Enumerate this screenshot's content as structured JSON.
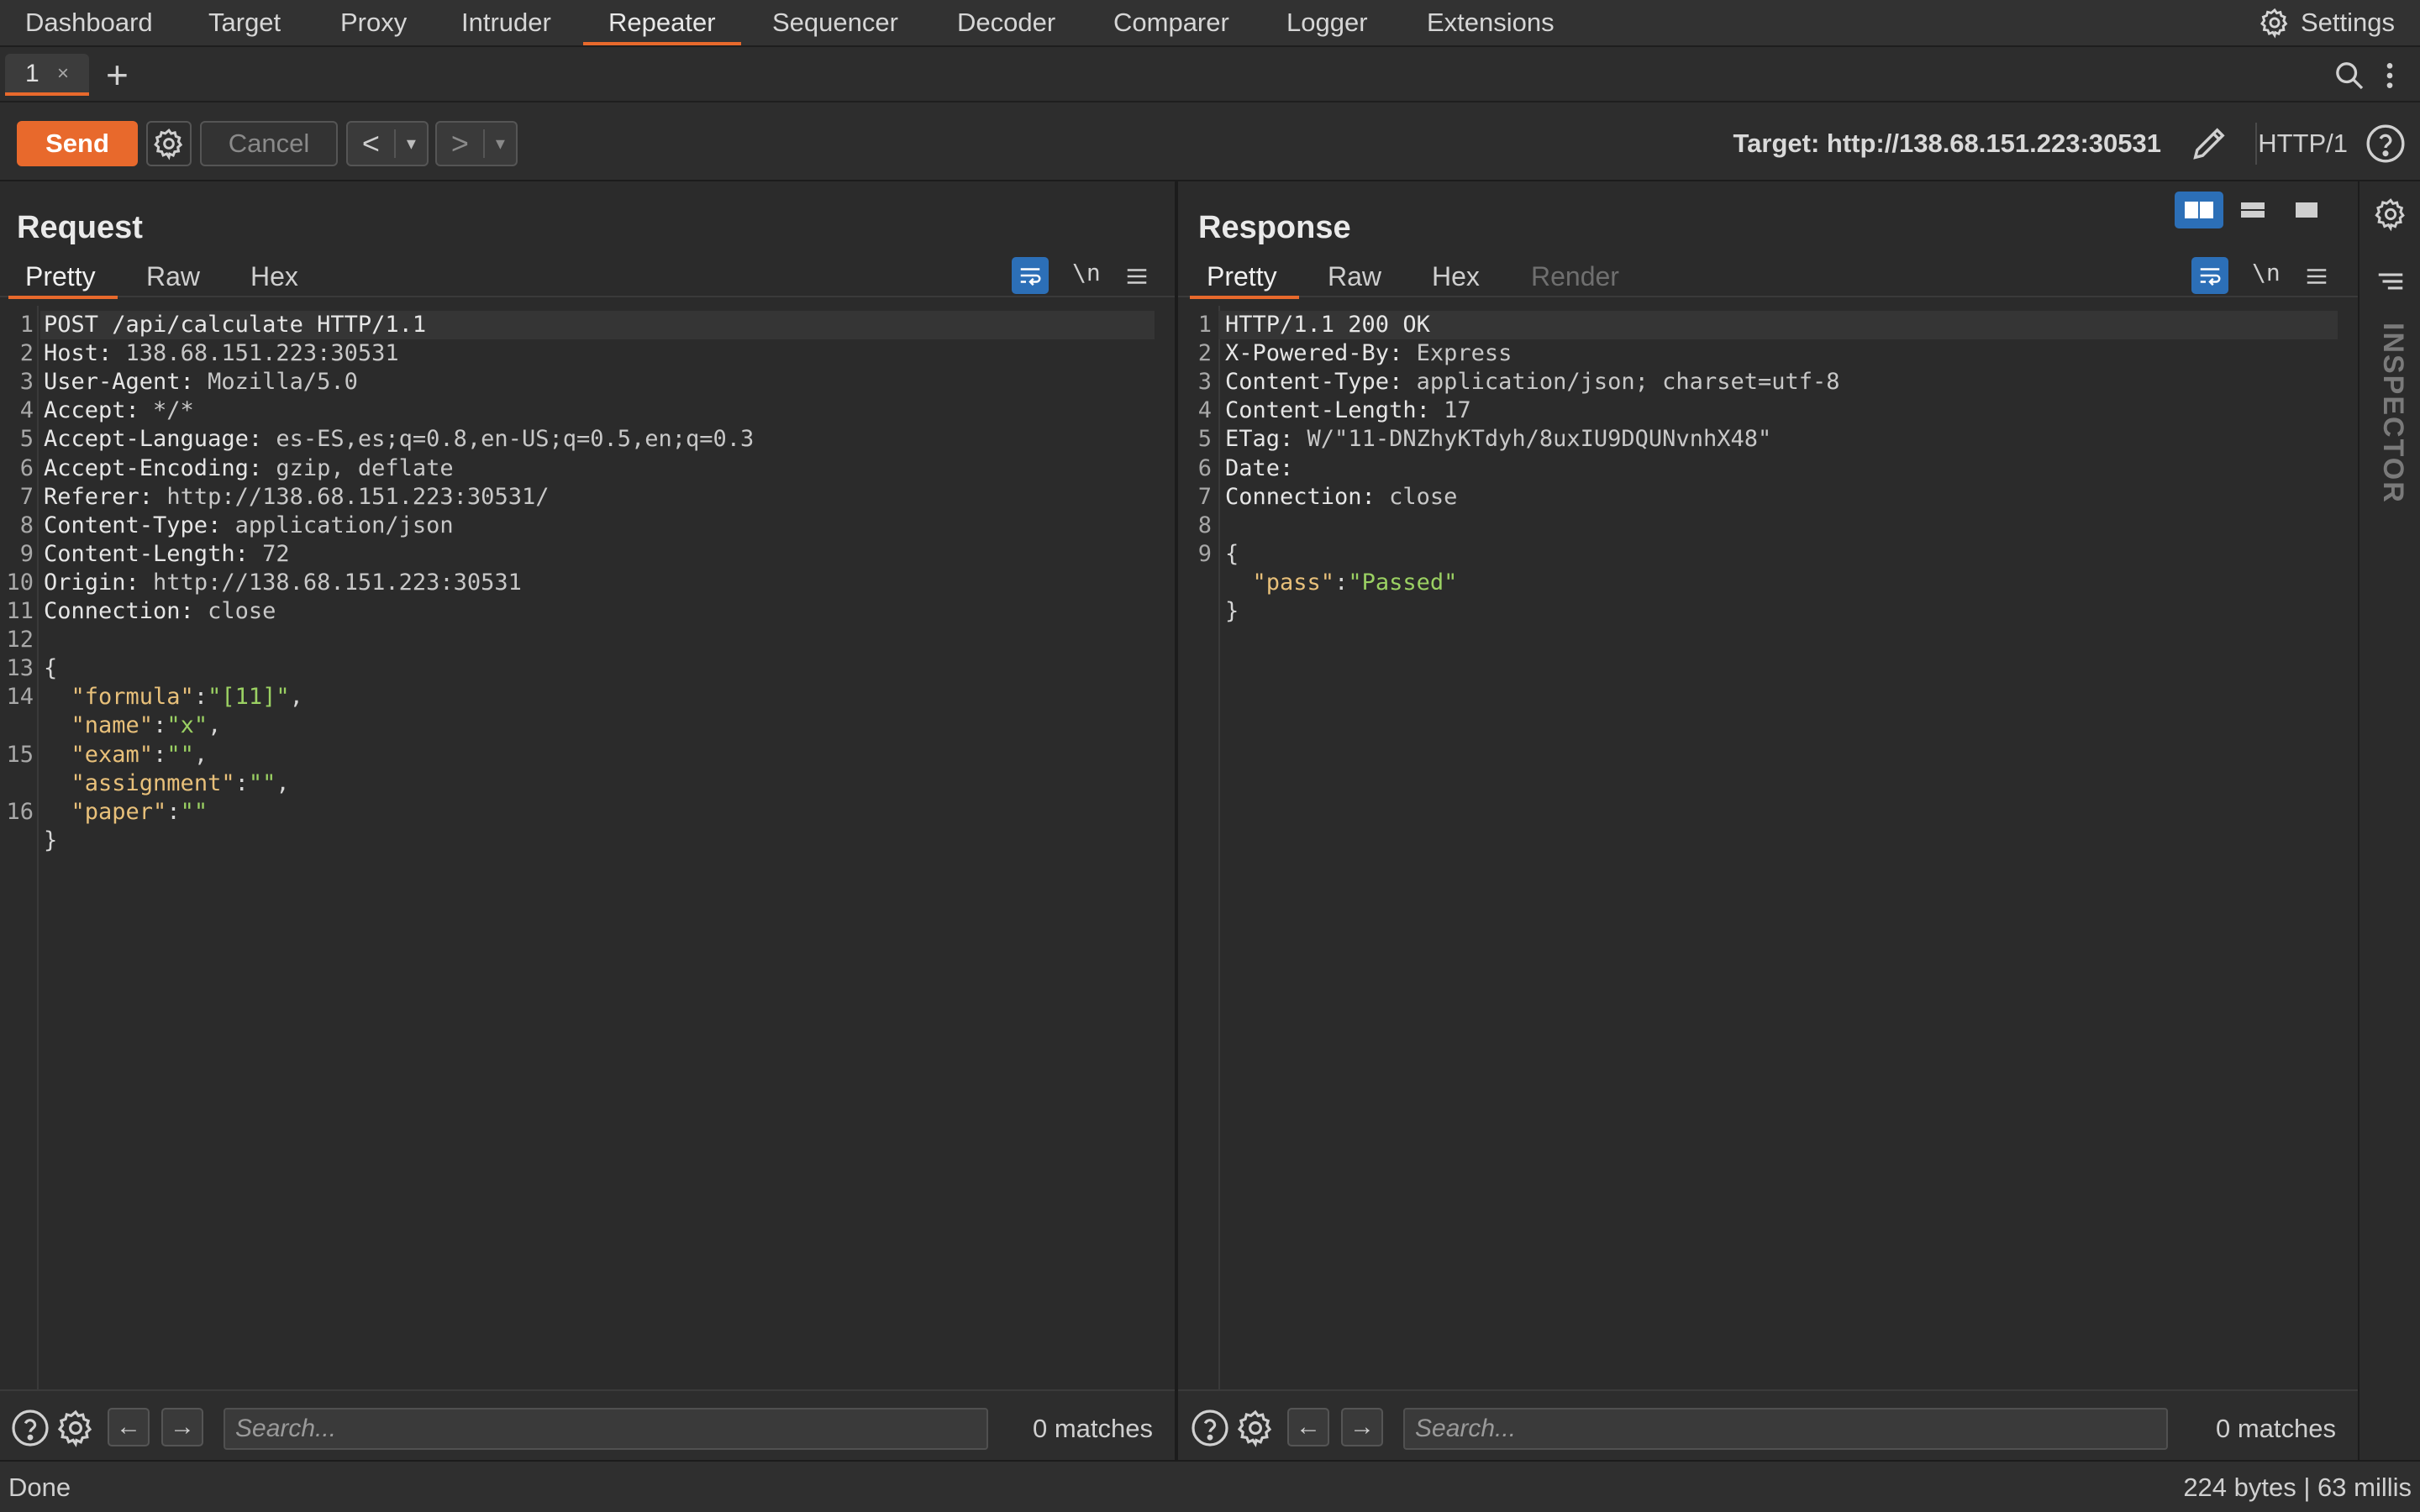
{
  "nav": {
    "items": [
      "Dashboard",
      "Target",
      "Proxy",
      "Intruder",
      "Repeater",
      "Sequencer",
      "Decoder",
      "Comparer",
      "Logger",
      "Extensions"
    ],
    "active": "Repeater",
    "settings_label": "Settings"
  },
  "tabs": {
    "items": [
      {
        "label": "1",
        "close": "×"
      }
    ],
    "add_label": "+"
  },
  "toolbar": {
    "send_label": "Send",
    "cancel_label": "Cancel",
    "back_label": "<",
    "forward_label": ">",
    "dropdown_glyph": "▾",
    "target_label": "Target: http://138.68.151.223:30531",
    "http_version": "HTTP/1"
  },
  "request": {
    "title": "Request",
    "tabs": [
      "Pretty",
      "Raw",
      "Hex"
    ],
    "active_tab": "Pretty",
    "newline_label": "\\n",
    "lines": [
      {
        "n": "1",
        "parts": [
          [
            "hk",
            "POST /api/calculate HTTP/1.1"
          ]
        ]
      },
      {
        "n": "2",
        "parts": [
          [
            "hk",
            "Host: "
          ],
          [
            "hv",
            "138.68.151.223:30531"
          ]
        ]
      },
      {
        "n": "3",
        "parts": [
          [
            "hk",
            "User-Agent: "
          ],
          [
            "hv",
            "Mozilla/5.0"
          ]
        ]
      },
      {
        "n": "4",
        "parts": [
          [
            "hk",
            "Accept: "
          ],
          [
            "hv",
            "*/*"
          ]
        ]
      },
      {
        "n": "5",
        "parts": [
          [
            "hk",
            "Accept-Language: "
          ],
          [
            "hv",
            "es-ES,es;q=0.8,en-US;q=0.5,en;q=0.3"
          ]
        ]
      },
      {
        "n": "6",
        "parts": [
          [
            "hk",
            "Accept-Encoding: "
          ],
          [
            "hv",
            "gzip, deflate"
          ]
        ]
      },
      {
        "n": "7",
        "parts": [
          [
            "hk",
            "Referer: "
          ],
          [
            "hv",
            "http://138.68.151.223:30531/"
          ]
        ]
      },
      {
        "n": "8",
        "parts": [
          [
            "hk",
            "Content-Type: "
          ],
          [
            "hv",
            "application/json"
          ]
        ]
      },
      {
        "n": "9",
        "parts": [
          [
            "hk",
            "Content-Length: "
          ],
          [
            "hv",
            "72"
          ]
        ]
      },
      {
        "n": "10",
        "parts": [
          [
            "hk",
            "Origin: "
          ],
          [
            "hv",
            "http://138.68.151.223:30531"
          ]
        ]
      },
      {
        "n": "11",
        "parts": [
          [
            "hk",
            "Connection: "
          ],
          [
            "hv",
            "close"
          ]
        ]
      },
      {
        "n": "12",
        "parts": []
      },
      {
        "n": "13",
        "parts": [
          [
            "jp",
            "{"
          ]
        ]
      },
      {
        "n": "14",
        "parts": [
          [
            "jp",
            "  "
          ],
          [
            "jk",
            "\"formula\""
          ],
          [
            "jp",
            ":"
          ],
          [
            "jv",
            "\"[11]\""
          ],
          [
            "jp",
            ","
          ]
        ]
      },
      {
        "n": "",
        "parts": [
          [
            "jp",
            "  "
          ],
          [
            "jk",
            "\"name\""
          ],
          [
            "jp",
            ":"
          ],
          [
            "jv",
            "\"x\""
          ],
          [
            "jp",
            ","
          ]
        ]
      },
      {
        "n": "15",
        "parts": [
          [
            "jp",
            "  "
          ],
          [
            "jk",
            "\"exam\""
          ],
          [
            "jp",
            ":"
          ],
          [
            "jv",
            "\"\""
          ],
          [
            "jp",
            ","
          ]
        ]
      },
      {
        "n": "",
        "parts": [
          [
            "jp",
            "  "
          ],
          [
            "jk",
            "\"assignment\""
          ],
          [
            "jp",
            ":"
          ],
          [
            "jv",
            "\"\""
          ],
          [
            "jp",
            ","
          ]
        ]
      },
      {
        "n": "16",
        "parts": [
          [
            "jp",
            "  "
          ],
          [
            "jk",
            "\"paper\""
          ],
          [
            "jp",
            ":"
          ],
          [
            "jv",
            "\"\""
          ]
        ]
      },
      {
        "n": "",
        "parts": [
          [
            "jp",
            "}"
          ]
        ]
      }
    ],
    "search_placeholder": "Search...",
    "matches": "0 matches"
  },
  "response": {
    "title": "Response",
    "tabs": [
      "Pretty",
      "Raw",
      "Hex",
      "Render"
    ],
    "active_tab": "Pretty",
    "newline_label": "\\n",
    "lines": [
      {
        "n": "1",
        "parts": [
          [
            "hk",
            "HTTP/1.1 200 OK"
          ]
        ]
      },
      {
        "n": "2",
        "parts": [
          [
            "hk",
            "X-Powered-By: "
          ],
          [
            "hv",
            "Express"
          ]
        ]
      },
      {
        "n": "3",
        "parts": [
          [
            "hk",
            "Content-Type: "
          ],
          [
            "hv",
            "application/json; charset=utf-8"
          ]
        ]
      },
      {
        "n": "4",
        "parts": [
          [
            "hk",
            "Content-Length: "
          ],
          [
            "hv",
            "17"
          ]
        ]
      },
      {
        "n": "5",
        "parts": [
          [
            "hk",
            "ETag: "
          ],
          [
            "hv",
            "W/\"11-DNZhyKTdyh/8uxIU9DQUNvnhX48\""
          ]
        ]
      },
      {
        "n": "6",
        "parts": [
          [
            "hk",
            "Date:"
          ]
        ]
      },
      {
        "n": "7",
        "parts": [
          [
            "hk",
            "Connection: "
          ],
          [
            "hv",
            "close"
          ]
        ]
      },
      {
        "n": "8",
        "parts": []
      },
      {
        "n": "9",
        "parts": [
          [
            "jp",
            "{"
          ]
        ]
      },
      {
        "n": "",
        "parts": [
          [
            "jp",
            "  "
          ],
          [
            "jk",
            "\"pass\""
          ],
          [
            "jp",
            ":"
          ],
          [
            "jv",
            "\"Passed\""
          ]
        ]
      },
      {
        "n": "",
        "parts": [
          [
            "jp",
            "}"
          ]
        ]
      }
    ],
    "search_placeholder": "Search...",
    "matches": "0 matches"
  },
  "inspector": {
    "label": "INSPECTOR"
  },
  "status": {
    "left": "Done",
    "right": "224 bytes | 63 millis"
  },
  "colors": {
    "accent": "#e8692c",
    "blue": "#2c6fb7",
    "json_key": "#e8c07a",
    "json_value": "#9bd163"
  }
}
